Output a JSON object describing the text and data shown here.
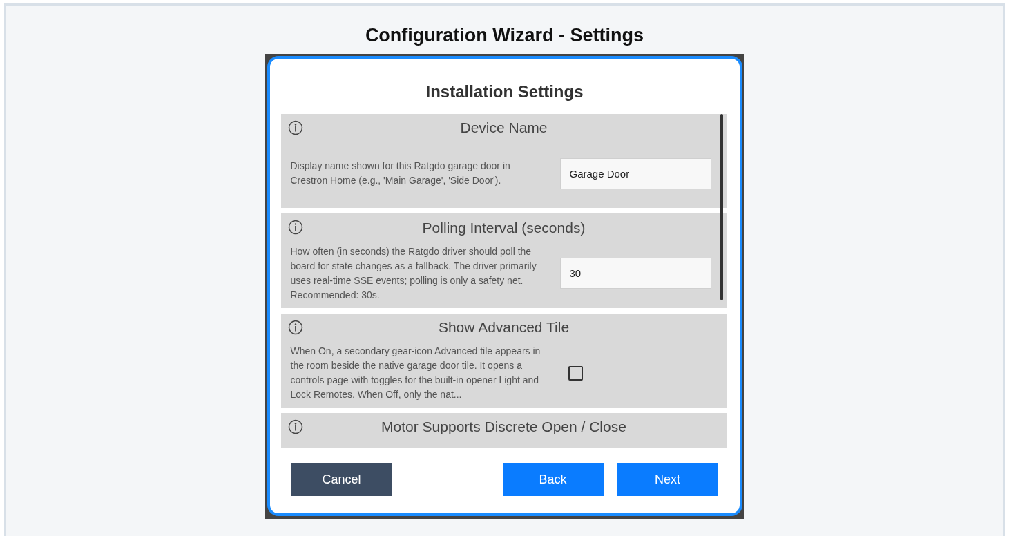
{
  "page_title": "Configuration Wizard - Settings",
  "dialog": {
    "title": "Installation Settings",
    "settings": [
      {
        "kind": "text",
        "label": "Device Name",
        "description": "Display name shown for this Ratgdo garage door in Crestron Home (e.g., 'Main Garage', 'Side Door').",
        "value": "Garage Door"
      },
      {
        "kind": "text",
        "label": "Polling Interval (seconds)",
        "description": "How often (in seconds) the Ratgdo driver should poll the board for state changes as a fallback. The driver primarily uses real-time SSE events; polling is only a safety net. Recommended: 30s.",
        "value": "30"
      },
      {
        "kind": "checkbox",
        "label": "Show Advanced Tile",
        "description": "When On, a secondary gear-icon Advanced tile appears in the room beside the native garage door tile. It opens a controls page with toggles for the built-in opener Light and Lock Remotes. When Off, only the nat...",
        "checked": false
      },
      {
        "kind": "header",
        "label": "Motor Supports Discrete Open / Close"
      }
    ],
    "buttons": [
      {
        "kind": "secondary",
        "label": "Cancel"
      },
      {
        "kind": "primary",
        "label": "Back"
      },
      {
        "kind": "primary",
        "label": "Next"
      }
    ]
  }
}
